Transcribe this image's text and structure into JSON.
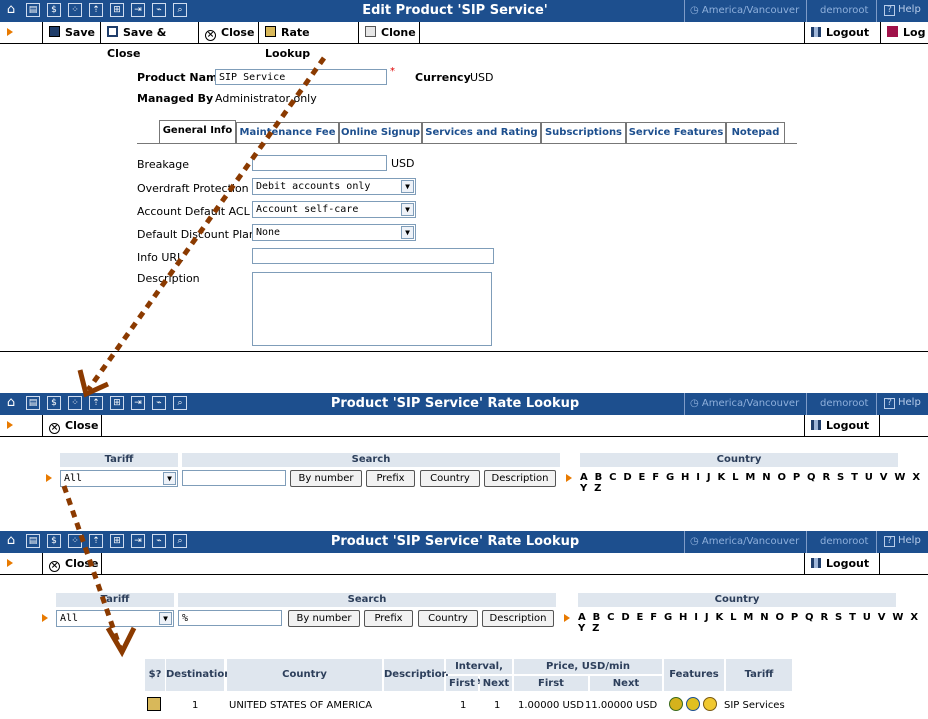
{
  "panel1": {
    "title": "Edit Product 'SIP Service'",
    "timezone": "America/Vancouver",
    "user": "demoroot",
    "help": "Help",
    "toolbar": {
      "save": "Save",
      "save_close": "Save & Close",
      "close": "Close",
      "rate_lookup": "Rate Lookup",
      "clone": "Clone",
      "logout": "Logout",
      "log": "Log"
    },
    "product_name_label": "Product Name",
    "product_name_value": "SIP Service",
    "currency_label": "Currency",
    "currency_value": "USD",
    "managed_by_label": "Managed By",
    "managed_by_value": "Administrator only",
    "tabs": [
      "General Info",
      "Maintenance Fee",
      "Online Signup",
      "Services and Rating",
      "Subscriptions",
      "Service Features",
      "Notepad"
    ],
    "breakage_label": "Breakage",
    "breakage_unit": "USD",
    "overdraft_label": "Overdraft Protection",
    "overdraft_value": "Debit accounts only",
    "acl_label": "Account Default ACL",
    "acl_value": "Account self-care",
    "discount_label": "Default Discount Plan",
    "discount_value": "None",
    "info_url_label": "Info URL",
    "description_label": "Description"
  },
  "panel2": {
    "title": "Product 'SIP Service' Rate Lookup",
    "timezone": "America/Vancouver",
    "user": "demoroot",
    "help": "Help",
    "close": "Close",
    "logout": "Logout",
    "tariff_header": "Tariff",
    "search_header": "Search",
    "country_header": "Country",
    "tariff_value": "All",
    "buttons": [
      "By number",
      "Prefix",
      "Country",
      "Description"
    ],
    "letters": "A B C D E F G H I J K L M N O P Q R S T U V W X Y Z"
  },
  "panel3": {
    "title": "Product 'SIP Service' Rate Lookup",
    "timezone": "America/Vancouver",
    "user": "demoroot",
    "help": "Help",
    "close": "Close",
    "logout": "Logout",
    "tariff_header": "Tariff",
    "search_header": "Search",
    "country_header": "Country",
    "tariff_value": "All",
    "search_value": "%",
    "buttons": [
      "By number",
      "Prefix",
      "Country",
      "Description"
    ],
    "letters": "A B C D E F G H I J K L M N O P Q R S T U V W X Y Z",
    "results": {
      "headers": {
        "dollar": "$?",
        "destination": "Destination",
        "country": "Country",
        "description": "Description",
        "interval": "Interval, sec.",
        "first": "First",
        "next": "Next",
        "price": "Price, USD/min",
        "price_first": "First",
        "price_next": "Next",
        "features": "Features",
        "tariff": "Tariff"
      },
      "rows": [
        {
          "destination": "1",
          "country": "UNITED STATES OF AMERICA",
          "description": "",
          "interval_first": "1",
          "interval_next": "1",
          "price_first": "1.00000 USD",
          "price_next": "11.00000 USD",
          "tariff": "SIP Services"
        }
      ]
    }
  },
  "colors": {
    "titlebar": "#1d4f8e",
    "accent": "#e87a00",
    "arrow": "#8b3a00"
  }
}
